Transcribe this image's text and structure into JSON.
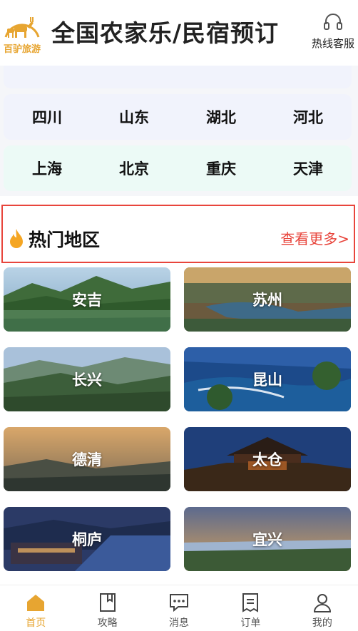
{
  "header": {
    "logo_text": "百驴旅游",
    "title": "全国农家乐/民宿预订",
    "hotline_label": "热线客服"
  },
  "provinces": {
    "row1": [
      "四川",
      "山东",
      "湖北",
      "河北"
    ],
    "row2": [
      "上海",
      "北京",
      "重庆",
      "天津"
    ]
  },
  "hot_section": {
    "title": "热门地区",
    "more": "查看更多>"
  },
  "regions": [
    "安吉",
    "苏州",
    "长兴",
    "昆山",
    "德清",
    "太仓",
    "桐庐",
    "宜兴"
  ],
  "tabbar": [
    {
      "label": "首页",
      "icon": "home-icon",
      "active": true
    },
    {
      "label": "攻略",
      "icon": "guide-book-icon",
      "active": false
    },
    {
      "label": "消息",
      "icon": "message-icon",
      "active": false
    },
    {
      "label": "订单",
      "icon": "order-icon",
      "active": false
    },
    {
      "label": "我的",
      "icon": "profile-icon",
      "active": false
    }
  ],
  "colors": {
    "accent": "#e7a531",
    "highlight_border": "#e8453c"
  }
}
